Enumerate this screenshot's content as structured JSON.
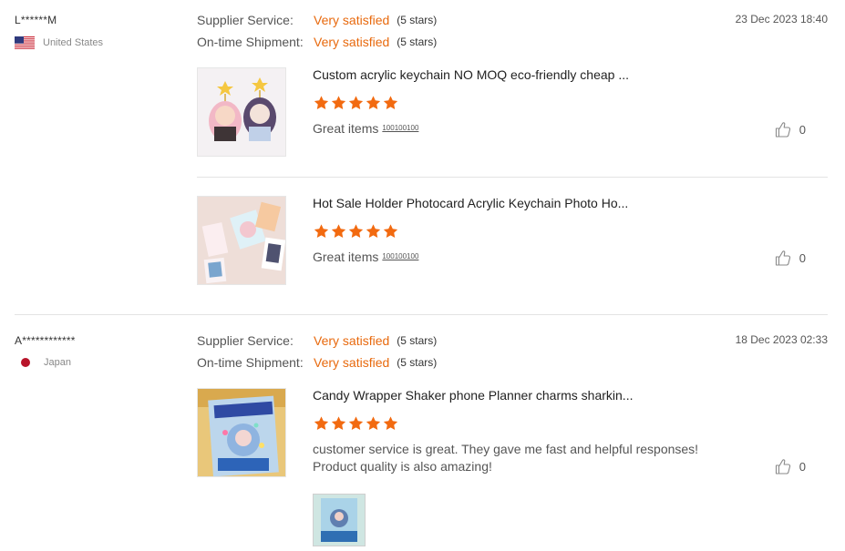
{
  "reviews": [
    {
      "buyer": "L******M",
      "country": "United States",
      "flag_icon": "us-flag-icon",
      "date": "23 Dec 2023 18:40",
      "supplier_service": {
        "label": "Supplier Service:",
        "value": "Very satisfied",
        "stars": "(5 stars)"
      },
      "shipment": {
        "label": "On-time Shipment:",
        "value": "Very satisfied",
        "stars": "(5 stars)"
      },
      "items": [
        {
          "title": "Custom acrylic keychain NO MOQ eco-friendly cheap ...",
          "rating": 5,
          "text": "Great items",
          "tag": "100100100",
          "likes": "0"
        },
        {
          "title": "Hot Sale Holder Photocard Acrylic Keychain Photo Ho...",
          "rating": 5,
          "text": "Great items",
          "tag": "100100100",
          "likes": "0"
        }
      ]
    },
    {
      "buyer": "A************",
      "country": "Japan",
      "flag_icon": "japan-flag-icon",
      "date": "18 Dec 2023 02:33",
      "supplier_service": {
        "label": "Supplier Service:",
        "value": "Very satisfied",
        "stars": "(5 stars)"
      },
      "shipment": {
        "label": "On-time Shipment:",
        "value": "Very satisfied",
        "stars": "(5 stars)"
      },
      "items": [
        {
          "title": "Candy Wrapper Shaker phone Planner charms sharkin...",
          "rating": 5,
          "text_line1": "customer service is great. They gave me fast and helpful responses!",
          "text_line2": "Product quality is also amazing!",
          "likes": "0"
        }
      ]
    }
  ],
  "colors": {
    "accent": "#e8690d",
    "star": "#f26a10"
  }
}
